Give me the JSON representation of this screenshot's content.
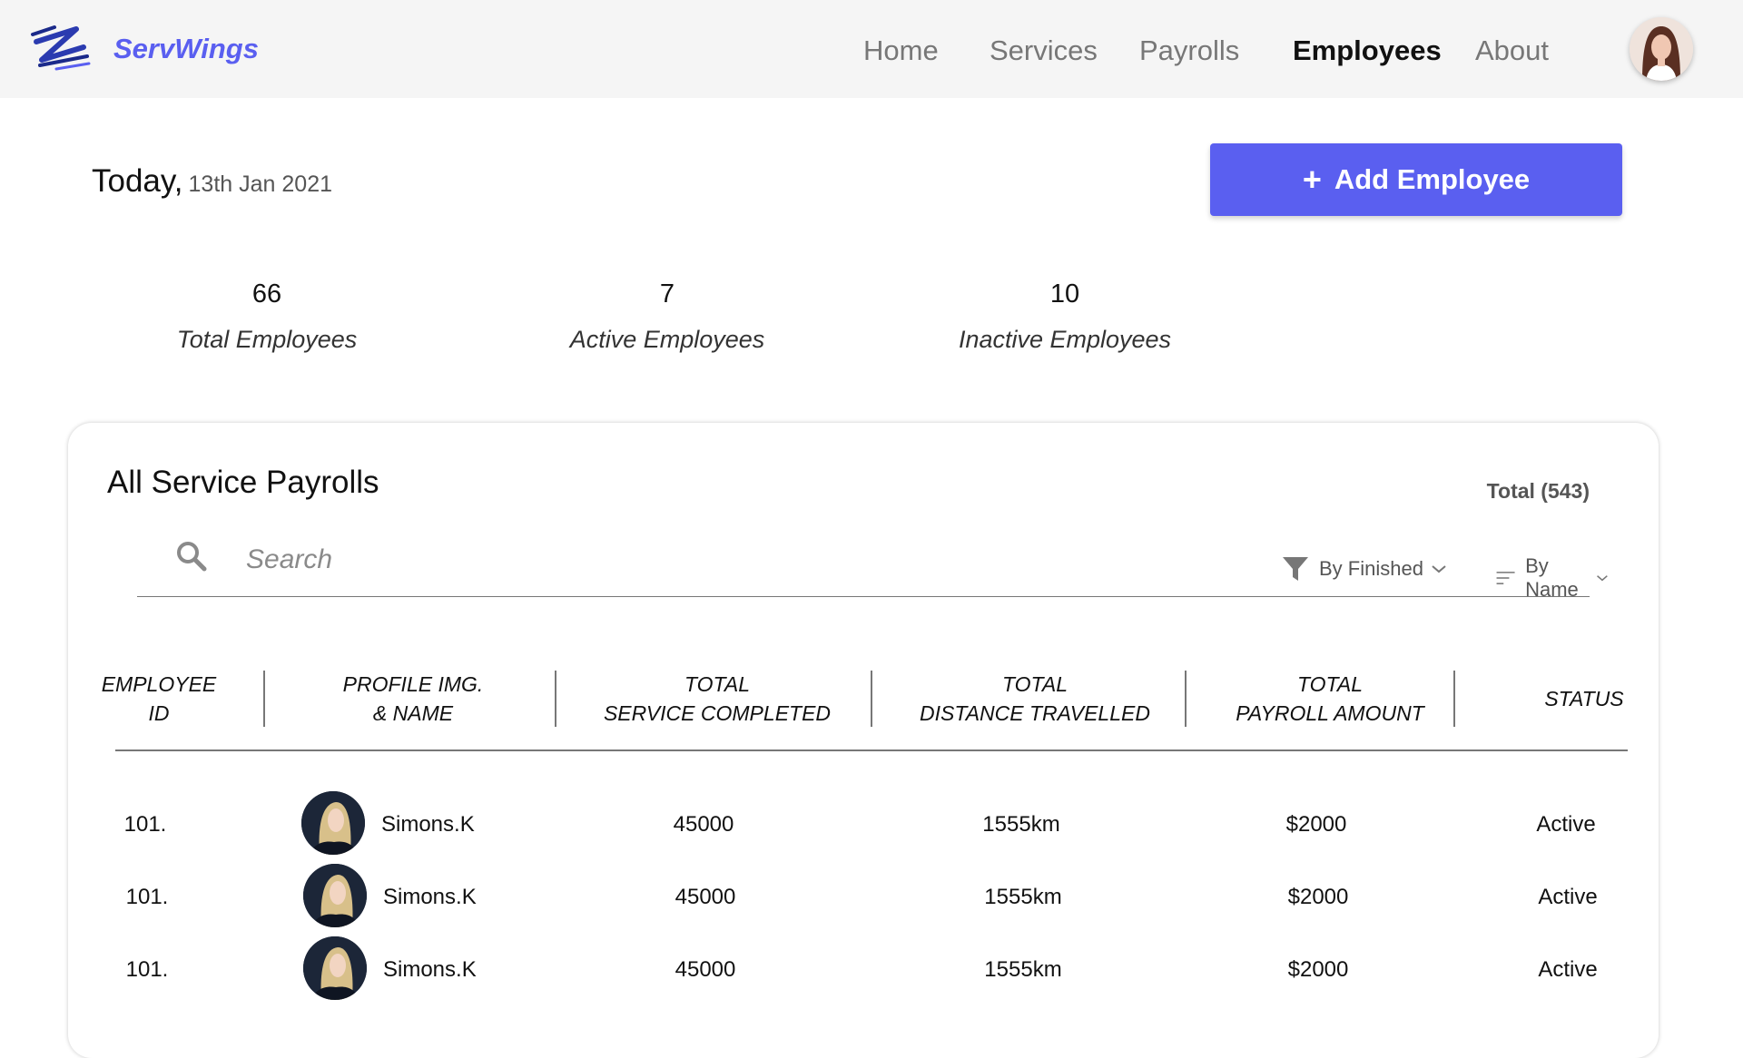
{
  "brand": {
    "name": "ServWings",
    "logo_icon": "servwings-logo-icon",
    "accent": "#5a5ff0"
  },
  "nav": {
    "items": [
      {
        "label": "Home"
      },
      {
        "label": "Services"
      },
      {
        "label": "Payrolls"
      },
      {
        "label": "Employees",
        "active": true
      },
      {
        "label": "About"
      }
    ],
    "avatar_icon": "user-avatar"
  },
  "header": {
    "today_label": "Today,",
    "date": "13th Jan 2021",
    "add_button": {
      "icon": "plus-icon",
      "label": "Add Employee"
    }
  },
  "stats": [
    {
      "value": "66",
      "label": "Total Employees"
    },
    {
      "value": "7",
      "label": "Active Employees"
    },
    {
      "value": "10",
      "label": "Inactive Employees"
    }
  ],
  "payrolls": {
    "title": "All Service Payrolls",
    "total": "Total (543)",
    "search": {
      "placeholder": "Search",
      "value": ""
    },
    "filter": {
      "icon": "funnel-icon",
      "label": "By Finished"
    },
    "sort": {
      "icon": "sort-lines-icon",
      "label": "By Name"
    },
    "columns": [
      {
        "line1": "EMPLOYEE",
        "line2": "ID"
      },
      {
        "line1": "PROFILE IMG.",
        "line2": "& NAME"
      },
      {
        "line1": "TOTAL",
        "line2": "SERVICE COMPLETED"
      },
      {
        "line1": "TOTAL",
        "line2": "DISTANCE TRAVELLED"
      },
      {
        "line1": "TOTAL",
        "line2": "PAYROLL AMOUNT"
      },
      {
        "line1": "STATUS",
        "line2": ""
      }
    ],
    "rows": [
      {
        "id": "101.",
        "name": "Simons.K",
        "services": "45000",
        "distance": "1555km",
        "amount": "$2000",
        "status": "Active"
      },
      {
        "id": "101.",
        "name": "Simons.K",
        "services": "45000",
        "distance": "1555km",
        "amount": "$2000",
        "status": "Active"
      },
      {
        "id": "101.",
        "name": "Simons.K",
        "services": "45000",
        "distance": "1555km",
        "amount": "$2000",
        "status": "Active"
      }
    ]
  }
}
